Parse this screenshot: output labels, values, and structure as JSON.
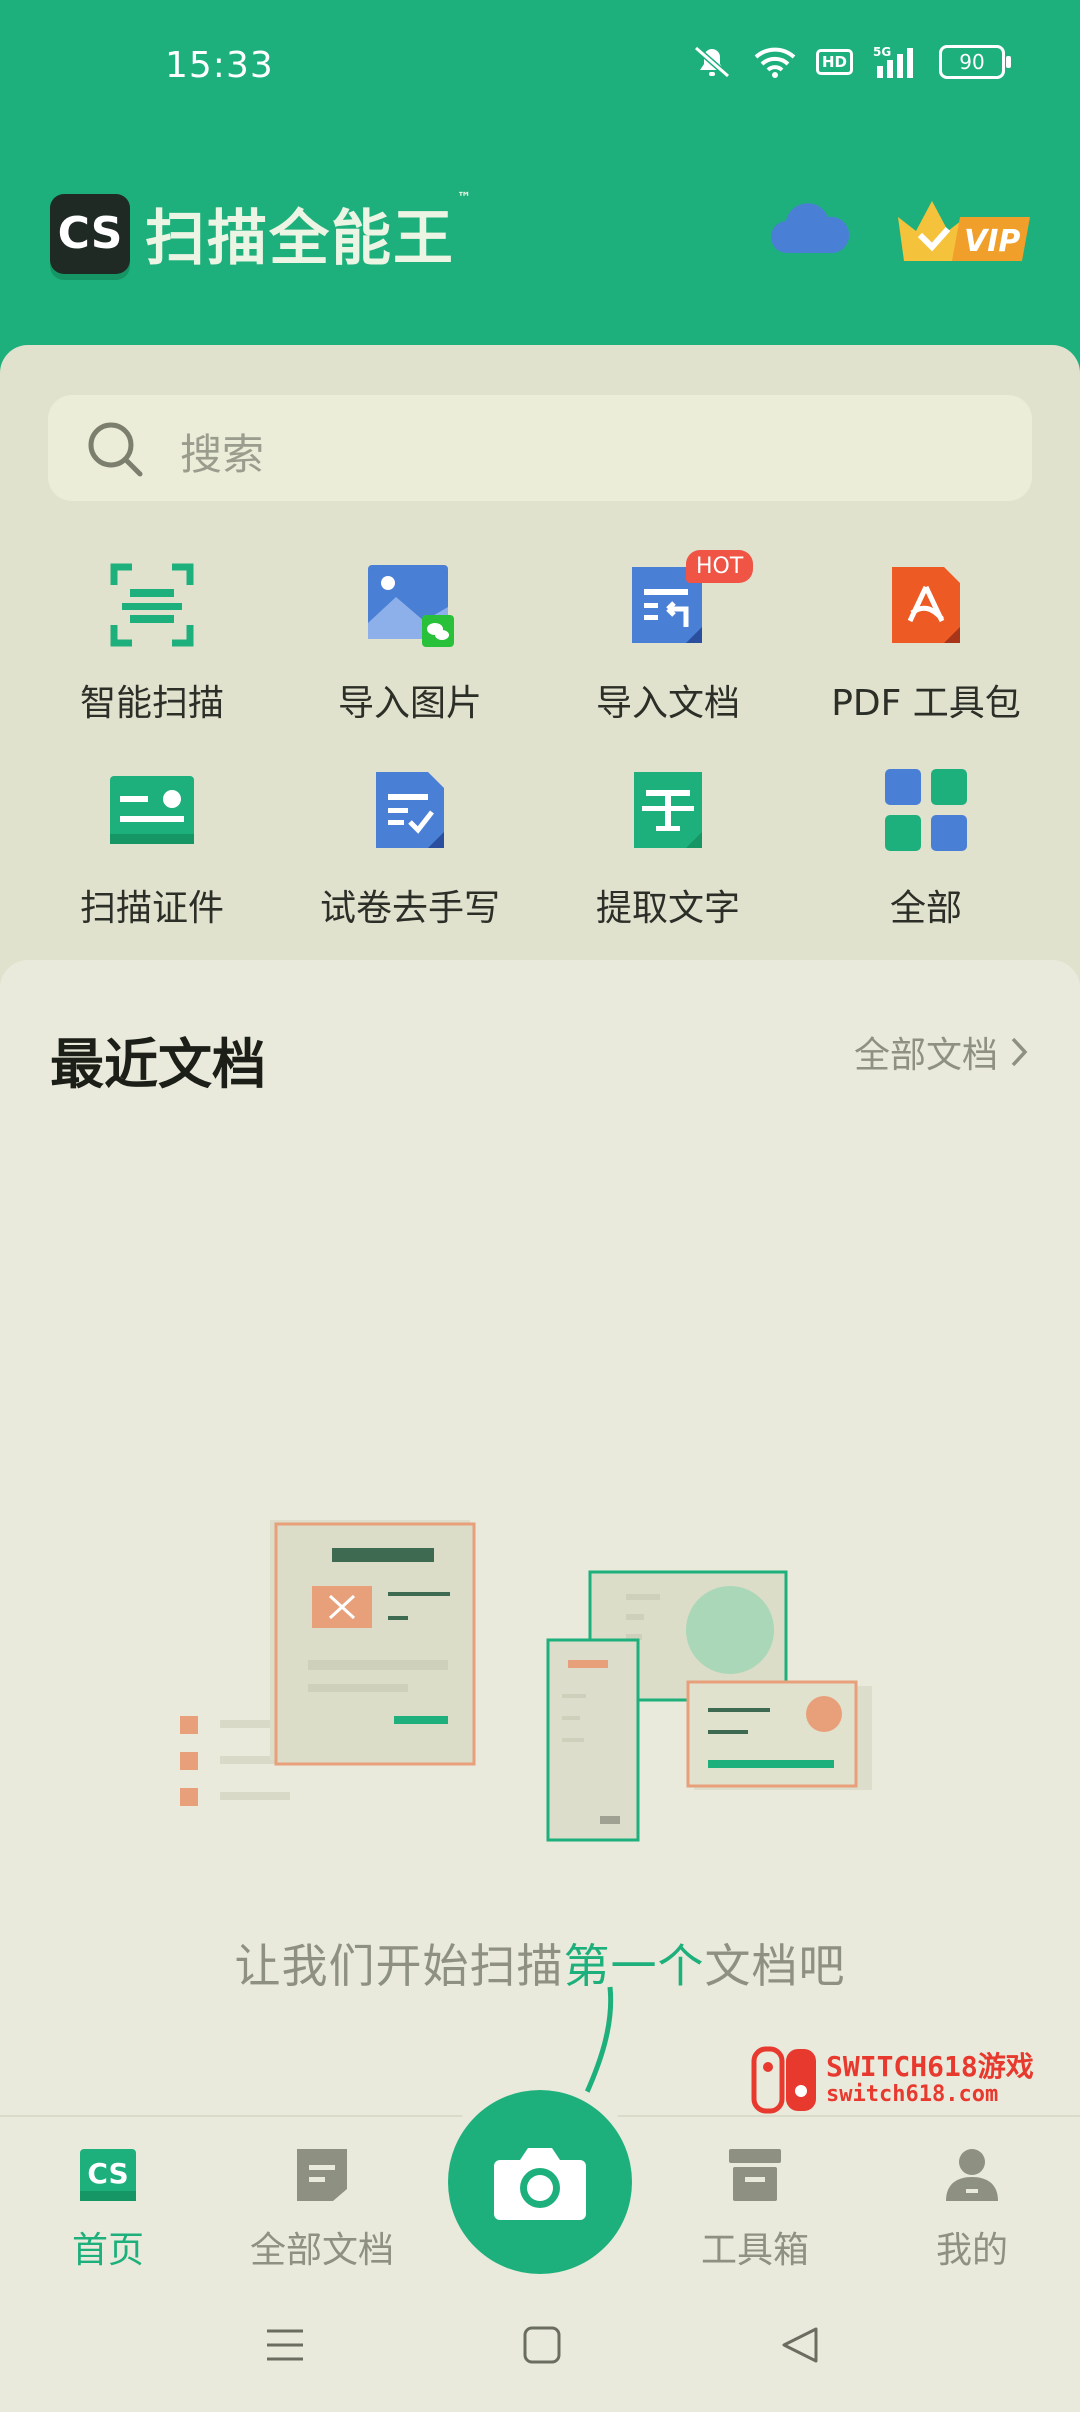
{
  "status_bar": {
    "time": "15:33",
    "battery": "90",
    "network": "5G",
    "hd": "HD"
  },
  "header": {
    "logo_text": "CS",
    "app_name": "扫描全能王",
    "trademark": "™",
    "vip_label": "VIP"
  },
  "search": {
    "placeholder": "搜索"
  },
  "tools": [
    {
      "label": "智能扫描",
      "icon": "scan-frame-icon"
    },
    {
      "label": "导入图片",
      "icon": "import-image-icon"
    },
    {
      "label": "导入文档",
      "icon": "import-document-icon",
      "badge": "HOT"
    },
    {
      "label": "PDF 工具包",
      "icon": "pdf-icon"
    },
    {
      "label": "扫描证件",
      "icon": "id-card-icon"
    },
    {
      "label": "试卷去手写",
      "icon": "exam-paper-icon"
    },
    {
      "label": "提取文字",
      "icon": "text-extract-icon"
    },
    {
      "label": "全部",
      "icon": "grid-all-icon"
    }
  ],
  "recent": {
    "title": "最近文档",
    "all_link": "全部文档",
    "empty_prefix": "让我们开始扫描",
    "empty_highlight": "第一个",
    "empty_suffix": "文档吧"
  },
  "watermark": {
    "line1": "SWITCH618游戏",
    "line2": "switch618.com"
  },
  "tabbar": {
    "home": "首页",
    "all_docs": "全部文档",
    "toolbox": "工具箱",
    "me": "我的",
    "home_logo": "CS"
  },
  "colors": {
    "brand": "#1eb07c",
    "hot": "#ef5444",
    "pdf": "#ee5a24",
    "blue": "#4a7fd6"
  }
}
